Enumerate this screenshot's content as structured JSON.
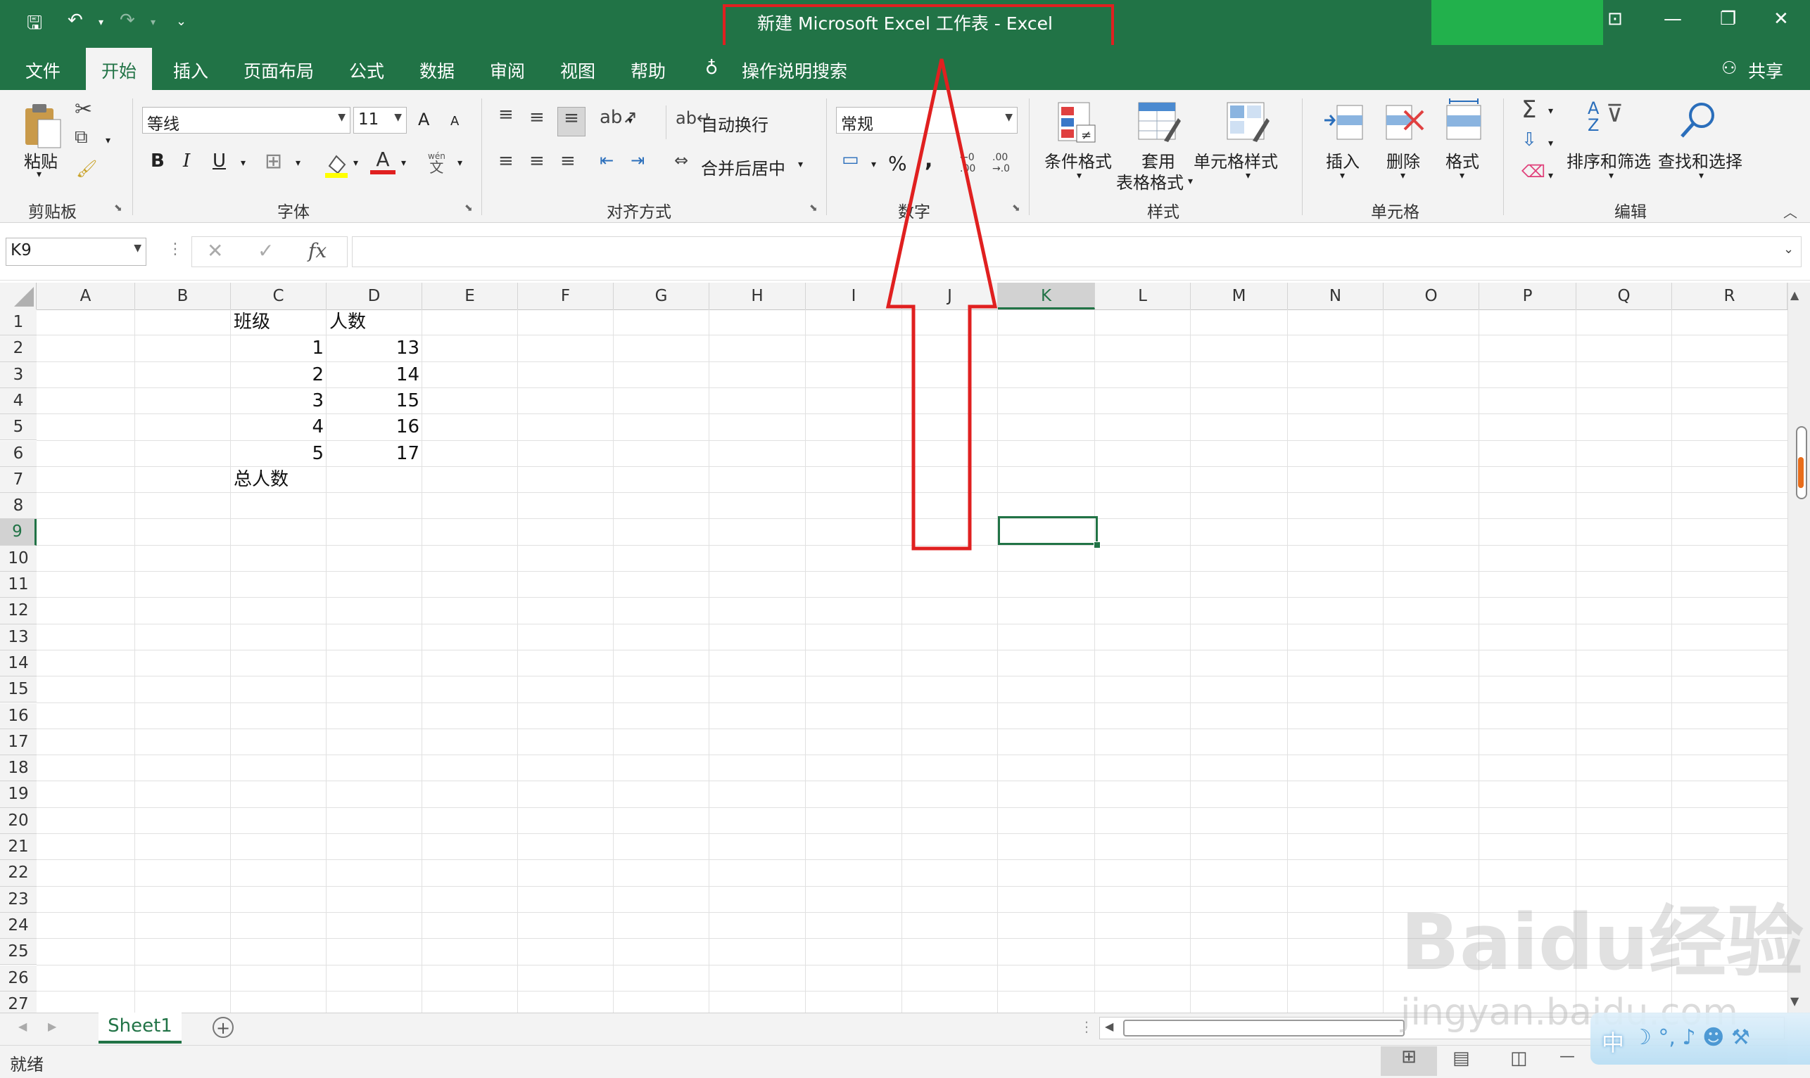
{
  "title": "新建 Microsoft Excel 工作表  -  Excel",
  "quick_access": {
    "save": "🖫",
    "undo": "↶",
    "redo": "↷",
    "more": "⌄"
  },
  "window": {
    "ribbon_display": "⊡",
    "minimize": "—",
    "restore": "❐",
    "close": "✕"
  },
  "tabs": [
    "文件",
    "开始",
    "插入",
    "页面布局",
    "公式",
    "数据",
    "审阅",
    "视图",
    "帮助"
  ],
  "active_tab": "开始",
  "tell_me": "操作说明搜索",
  "share": "共享",
  "ribbon": {
    "clipboard": {
      "paste": "粘贴",
      "label": "剪贴板"
    },
    "font": {
      "name": "等线",
      "size": "11",
      "grow": "A",
      "shrink": "A",
      "bold": "B",
      "italic": "I",
      "underline": "U",
      "label": "字体",
      "phonetic_top": "wén",
      "phonetic_bottom": "文"
    },
    "alignment": {
      "wrap": "自动换行",
      "merge": "合并后居中",
      "label": "对齐方式"
    },
    "number": {
      "format": "常规",
      "percent": "%",
      "comma": ",",
      "inc_dec_top": "←0",
      "inc_dec_bottom": ".00",
      "dec_dec_top": ".00",
      "dec_dec_bottom": "→.0",
      "label": "数字"
    },
    "styles": {
      "conditional": "条件格式",
      "table_line1": "套用",
      "table_line2": "表格格式",
      "cell_styles": "单元格样式",
      "label": "样式"
    },
    "cells": {
      "insert": "插入",
      "delete": "删除",
      "format": "格式",
      "label": "单元格"
    },
    "editing": {
      "sort": "排序和筛选",
      "find": "查找和选择",
      "label": "编辑",
      "sort_a": "A",
      "sort_z": "Z"
    }
  },
  "formula_bar": {
    "name_box": "K9",
    "fx": "fx",
    "value": ""
  },
  "columns": [
    "A",
    "B",
    "C",
    "D",
    "E",
    "F",
    "G",
    "H",
    "I",
    "J",
    "K",
    "L",
    "M",
    "N",
    "O",
    "P",
    "Q",
    "R"
  ],
  "rows": [
    "1",
    "2",
    "3",
    "4",
    "5",
    "6",
    "7",
    "8",
    "9",
    "10",
    "11",
    "12",
    "13",
    "14",
    "15",
    "16",
    "17",
    "18",
    "19",
    "20",
    "21",
    "22",
    "23",
    "24",
    "25",
    "26",
    "27"
  ],
  "cells": {
    "C1": "班级",
    "D1": "人数",
    "C2": "1",
    "D2": "13",
    "C3": "2",
    "D3": "14",
    "C4": "3",
    "D4": "15",
    "C5": "4",
    "D5": "16",
    "C6": "5",
    "D6": "17",
    "C7": "总人数"
  },
  "selected_cell": "K9",
  "sheet_tab": "Sheet1",
  "status": "就绪",
  "watermark": {
    "text": "Baidu经验",
    "url": "jingyan.baidu.com"
  },
  "colors": {
    "excel_green": "#217346",
    "annotation_red": "#e02020"
  }
}
